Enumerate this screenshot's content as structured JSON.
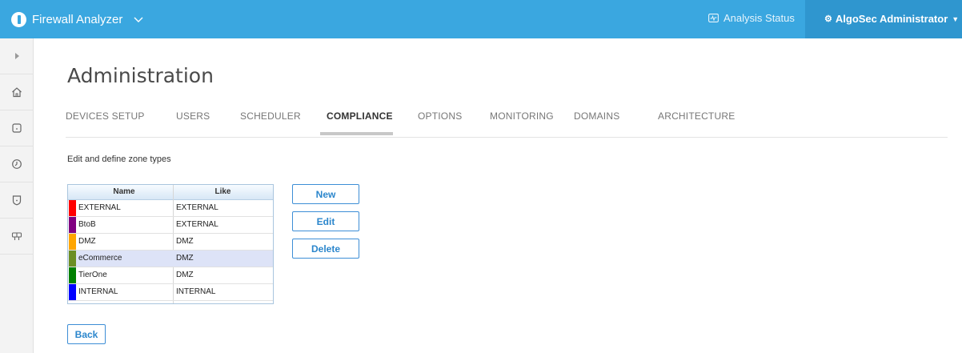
{
  "app": {
    "title": "Firewall Analyzer",
    "analysis_status": "Analysis Status",
    "user_menu": "AlgoSec Administrator",
    "accent_color": "#3aa7e0"
  },
  "sidebar": {
    "items": [
      {
        "icon": "expand-icon"
      },
      {
        "icon": "home-icon"
      },
      {
        "icon": "device-icon"
      },
      {
        "icon": "clock-icon"
      },
      {
        "icon": "shield-icon"
      },
      {
        "icon": "policy-icon"
      }
    ]
  },
  "page": {
    "title": "Administration",
    "description": "Edit and define zone types"
  },
  "tabs": [
    {
      "label": "DEVICES SETUP",
      "active": false
    },
    {
      "label": "USERS",
      "active": false
    },
    {
      "label": "SCHEDULER",
      "active": false
    },
    {
      "label": "COMPLIANCE",
      "active": true
    },
    {
      "label": "OPTIONS",
      "active": false
    },
    {
      "label": "MONITORING",
      "active": false
    },
    {
      "label": "DOMAINS",
      "active": false
    },
    {
      "label": "ARCHITECTURE",
      "active": false
    }
  ],
  "zone_table": {
    "columns": [
      "Name",
      "Like"
    ],
    "rows": [
      {
        "name": "EXTERNAL",
        "like": "EXTERNAL",
        "color": "#ff0000",
        "selected": false
      },
      {
        "name": "BtoB",
        "like": "EXTERNAL",
        "color": "#800080",
        "selected": false
      },
      {
        "name": "DMZ",
        "like": "DMZ",
        "color": "#ffa500",
        "selected": false
      },
      {
        "name": "eCommerce",
        "like": "DMZ",
        "color": "#6b8e23",
        "selected": true
      },
      {
        "name": "TierOne",
        "like": "DMZ",
        "color": "#008000",
        "selected": false
      },
      {
        "name": "INTERNAL",
        "like": "INTERNAL",
        "color": "#0000ff",
        "selected": false
      }
    ]
  },
  "actions": {
    "new_label": "New",
    "edit_label": "Edit",
    "delete_label": "Delete",
    "back_label": "Back"
  }
}
